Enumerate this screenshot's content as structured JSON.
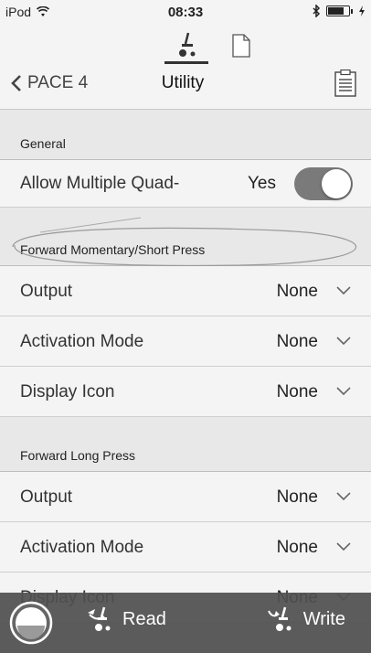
{
  "status_bar": {
    "carrier": "iPod",
    "time": "08:33",
    "wifi_icon": "wifi-icon",
    "bluetooth_icon": "bluetooth-icon",
    "battery_icon": "battery-charging-icon"
  },
  "nav": {
    "back_label": "PACE 4",
    "title": "Utility",
    "tabs": [
      {
        "icon": "wheelchair-icon",
        "active": true
      },
      {
        "icon": "document-icon",
        "active": false
      }
    ],
    "clipboard_icon": "clipboard-icon"
  },
  "sections": {
    "general": {
      "title": "General",
      "rows": [
        {
          "label": "Allow Multiple Quad-",
          "value": "Yes",
          "toggle_on": true
        }
      ]
    },
    "forward_momentary": {
      "title": "Forward Momentary/Short Press",
      "rows": [
        {
          "label": "Output",
          "value": "None"
        },
        {
          "label": "Activation Mode",
          "value": "None"
        },
        {
          "label": "Display Icon",
          "value": "None"
        }
      ]
    },
    "forward_long": {
      "title": "Forward Long Press",
      "rows": [
        {
          "label": "Output",
          "value": "None"
        },
        {
          "label": "Activation Mode",
          "value": "None"
        },
        {
          "label": "Display Icon",
          "value": "None"
        }
      ]
    }
  },
  "toolbar": {
    "power_icon": "power-icon",
    "read_label": "Read",
    "write_label": "Write"
  },
  "colors": {
    "background": "#e8e8e8",
    "row_background": "#f4f4f4",
    "toolbar_background": "#505050",
    "toggle_on": "#7a7a7a"
  }
}
